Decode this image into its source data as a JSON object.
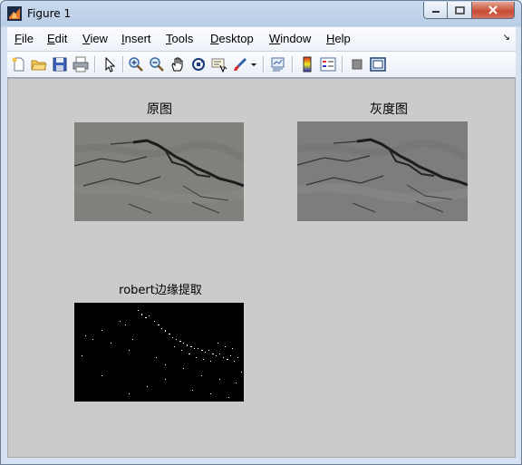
{
  "window": {
    "title": "Figure 1"
  },
  "menu": {
    "items": [
      {
        "ul": "F",
        "rest": "ile"
      },
      {
        "ul": "E",
        "rest": "dit"
      },
      {
        "ul": "V",
        "rest": "iew"
      },
      {
        "ul": "I",
        "rest": "nsert"
      },
      {
        "ul": "T",
        "rest": "ools"
      },
      {
        "ul": "D",
        "rest": "esktop"
      },
      {
        "ul": "W",
        "rest": "indow"
      },
      {
        "ul": "H",
        "rest": "elp"
      }
    ]
  },
  "toolbar": {
    "icons": [
      "new-figure-icon",
      "open-file-icon",
      "save-icon",
      "print-icon",
      "pointer-icon",
      "zoom-in-icon",
      "zoom-out-icon",
      "pan-hand-icon",
      "rotate-3d-icon",
      "data-cursor-icon",
      "brush-icon",
      "brush-dropdown-icon",
      "link-plot-icon",
      "colorbar-icon",
      "legend-icon",
      "hide-plot-tools-icon",
      "show-plot-tools-icon"
    ]
  },
  "plots": {
    "original_title": "原图",
    "gray_title": "灰度图",
    "robert_title": "robert边缘提取"
  },
  "colors": {
    "figure_bg": "#cbcbcb",
    "close_red": "#c74a32"
  }
}
